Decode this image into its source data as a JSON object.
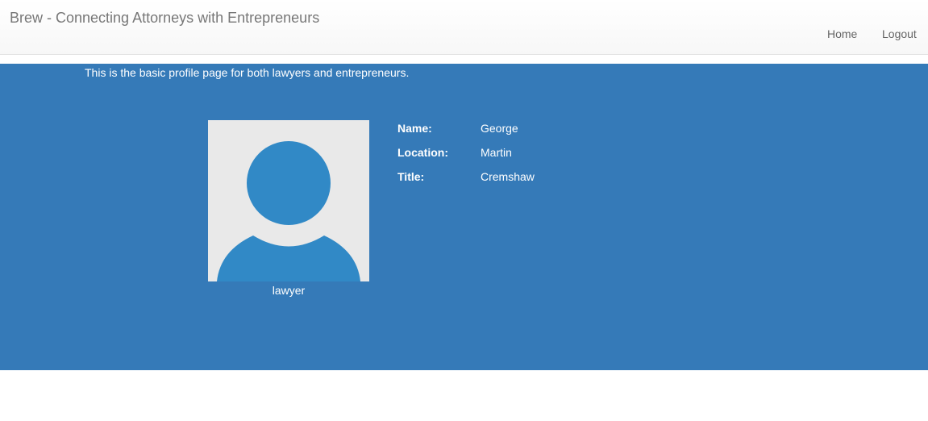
{
  "navbar": {
    "brand": "Brew - Connecting Attorneys with Entrepreneurs",
    "links": [
      {
        "label": "Home"
      },
      {
        "label": "Logout"
      }
    ]
  },
  "main": {
    "intro": "This is the basic profile page for both lawyers and entrepreneurs.",
    "avatar": {
      "icon": "user-silhouette-icon",
      "color": "#3189c6"
    },
    "role": "lawyer",
    "fields": [
      {
        "label": "Name:",
        "value": "George"
      },
      {
        "label": "Location:",
        "value": "Martin"
      },
      {
        "label": "Title:",
        "value": "Cremshaw"
      }
    ]
  },
  "colors": {
    "hero": "#357ab8"
  }
}
